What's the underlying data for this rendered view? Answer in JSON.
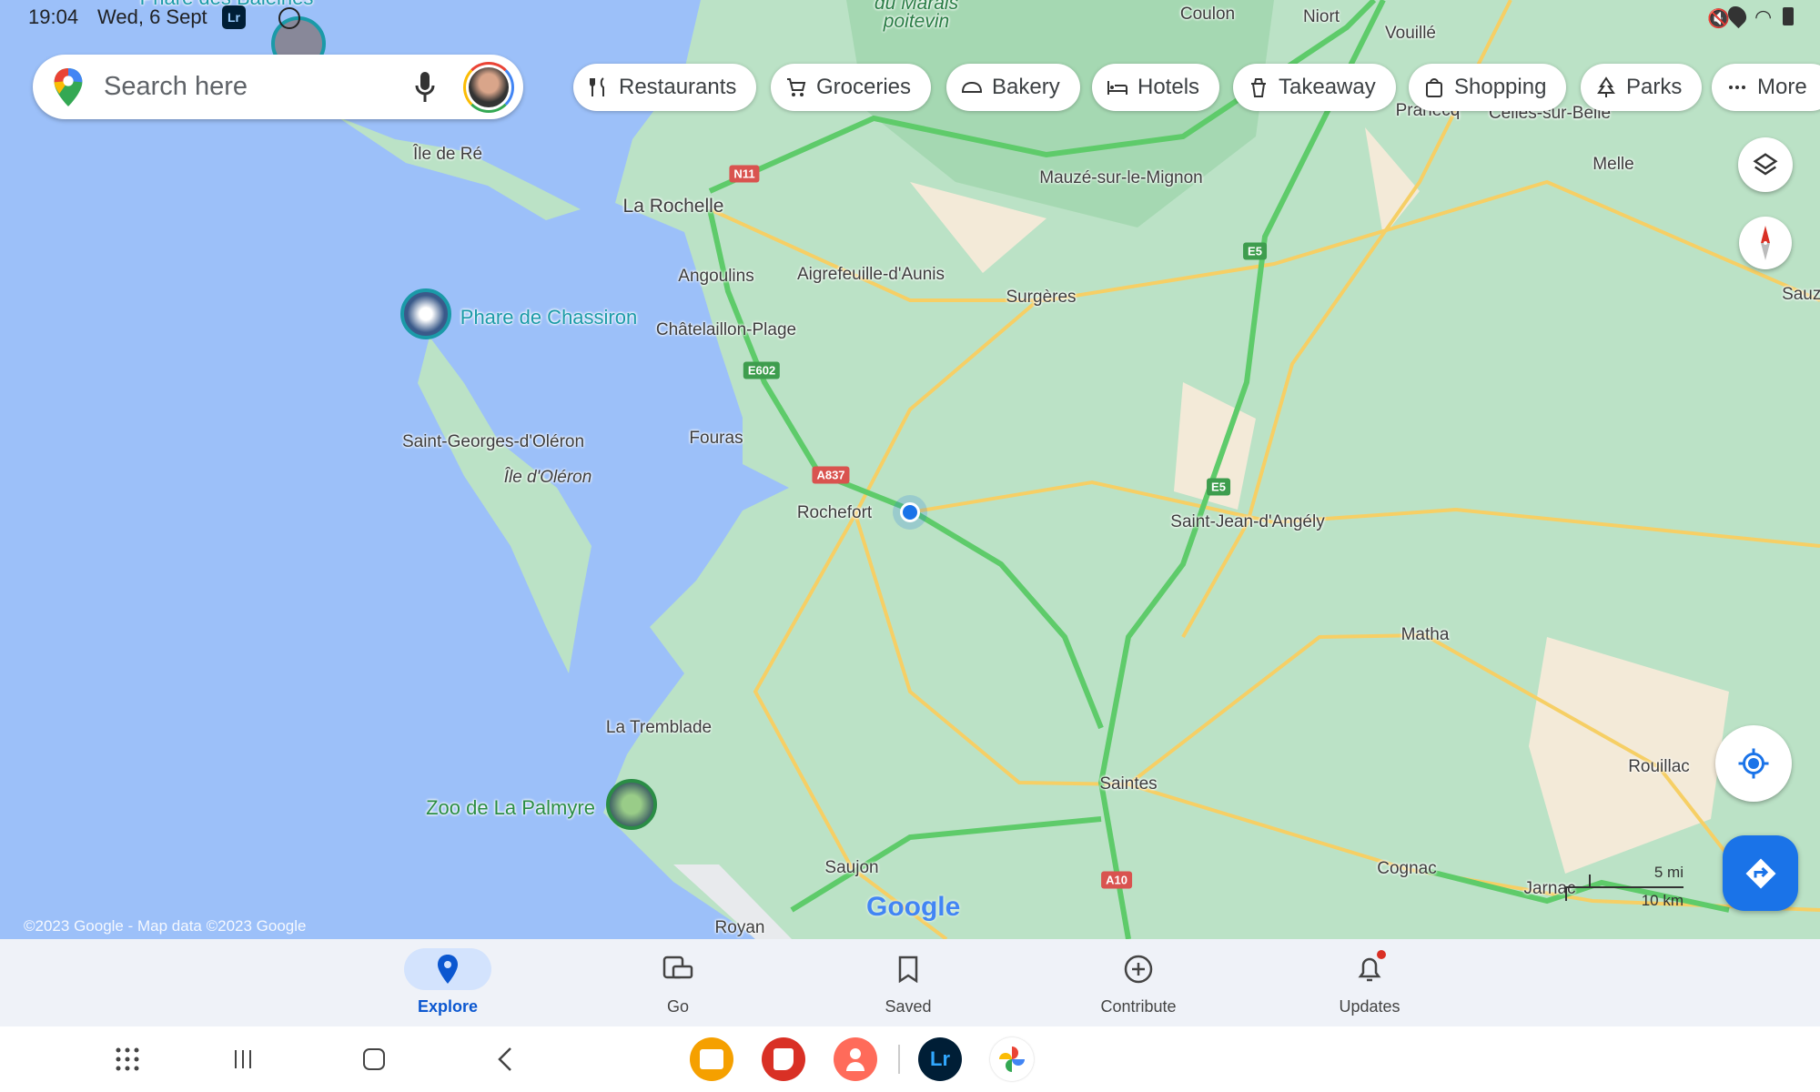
{
  "status_bar": {
    "time": "19:04",
    "date": "Wed, 6 Sept",
    "lr_badge": "Lr"
  },
  "search": {
    "placeholder": "Search here"
  },
  "chips": [
    {
      "label": "Restaurants",
      "icon": "fork-knife-icon"
    },
    {
      "label": "Groceries",
      "icon": "cart-icon"
    },
    {
      "label": "Bakery",
      "icon": "bread-icon"
    },
    {
      "label": "Hotels",
      "icon": "bed-icon"
    },
    {
      "label": "Takeaway",
      "icon": "takeaway-cup-icon"
    },
    {
      "label": "Shopping",
      "icon": "shopping-bag-icon"
    },
    {
      "label": "Parks",
      "icon": "tree-icon"
    },
    {
      "label": "More",
      "icon": "more-dots-icon"
    }
  ],
  "map": {
    "places": [
      "du Marais",
      "poitevin",
      "Coulon",
      "Niort",
      "Vouillé",
      "Île de Ré",
      "La Rochelle",
      "Mauzé-sur-le-Mignon",
      "Melle",
      "Prahecq",
      "Celles-sur-Belle",
      "Angoulins",
      "Aigrefeuille-d'Aunis",
      "Surgères",
      "Châtelaillon-Plage",
      "Sauzé",
      "Saint-Georges-d'Oléron",
      "Fouras",
      "Île d'Oléron",
      "Rochefort",
      "Saint-Jean-d'Angély",
      "Matha",
      "La Tremblade",
      "Saintes",
      "Rouillac",
      "Saujon",
      "Cognac",
      "Jarnac",
      "Royan"
    ],
    "pois": [
      "Phare des Baleines",
      "Phare de Chassiron",
      "Zoo de La Palmyre"
    ],
    "roads": [
      "N11",
      "E5",
      "E602",
      "A837",
      "E5",
      "A10"
    ],
    "scale": {
      "imperial": "5 mi",
      "metric": "10 km"
    },
    "logo": "Google",
    "copyright": "©2023 Google - Map data ©2023 Google",
    "colors": {
      "sea": "#9cc0f9",
      "land": "#bbe2c6",
      "highway": "#5ecb6a",
      "road": "#f6cf65",
      "accent": "#1a73e8"
    }
  },
  "nav": [
    {
      "label": "Explore",
      "icon": "explore-pin-icon",
      "active": true
    },
    {
      "label": "Go",
      "icon": "commute-icon"
    },
    {
      "label": "Saved",
      "icon": "bookmark-icon"
    },
    {
      "label": "Contribute",
      "icon": "add-circle-icon"
    },
    {
      "label": "Updates",
      "icon": "bell-icon",
      "badge": true
    }
  ],
  "taskbar": {
    "apps": [
      "files-icon",
      "notes-icon",
      "contacts-icon",
      "lightroom-icon",
      "photos-icon"
    ],
    "lightroom_label": "Lr"
  }
}
